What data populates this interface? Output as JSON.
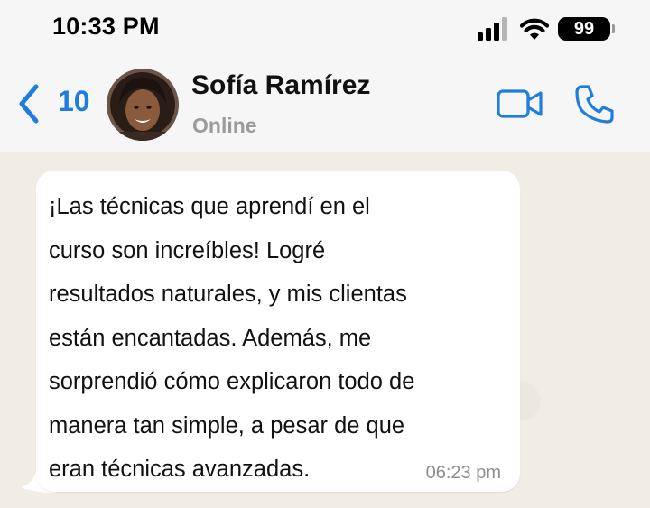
{
  "status_bar": {
    "time": "10:33 PM",
    "battery": "99",
    "icons": [
      "cellular-signal-icon",
      "wifi-icon",
      "battery-icon"
    ]
  },
  "header": {
    "back_count": "10",
    "contact_name": "Sofía Ramírez",
    "contact_status": "Online",
    "icons": [
      "chevron-left-icon",
      "video-camera-icon",
      "phone-icon"
    ]
  },
  "colors": {
    "accent": "#1f7de0",
    "header_bg": "#f6f6f6",
    "chat_bg": "#f1ece4",
    "bubble_bg": "#ffffff",
    "status_gray": "#9b9b9b"
  },
  "messages": [
    {
      "direction": "incoming",
      "text": "¡Las técnicas que aprendí en el\ncurso son increíbles! Logré\nresultados naturales, y mis clientas\nestán encantadas. Además, me\nsorprendió cómo explicaron todo de\nmanera tan simple, a pesar de que\neran técnicas avanzadas.",
      "time": "06:23 pm"
    }
  ]
}
